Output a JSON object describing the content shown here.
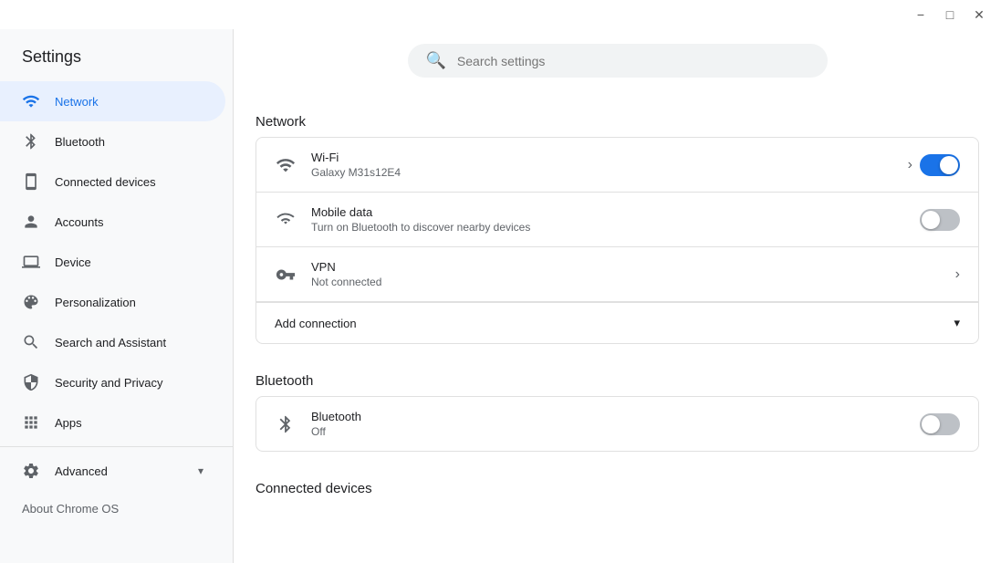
{
  "window": {
    "title": "Settings"
  },
  "titlebar": {
    "minimize_label": "−",
    "maximize_label": "□",
    "close_label": "✕"
  },
  "sidebar": {
    "title": "Settings",
    "items": [
      {
        "id": "network",
        "label": "Network",
        "icon": "network"
      },
      {
        "id": "bluetooth",
        "label": "Bluetooth",
        "icon": "bluetooth"
      },
      {
        "id": "connected-devices",
        "label": "Connected devices",
        "icon": "connected-devices"
      },
      {
        "id": "accounts",
        "label": "Accounts",
        "icon": "accounts"
      },
      {
        "id": "device",
        "label": "Device",
        "icon": "device"
      },
      {
        "id": "personalization",
        "label": "Personalization",
        "icon": "personalization"
      },
      {
        "id": "search-and-assistant",
        "label": "Search and Assistant",
        "icon": "search-assistant"
      },
      {
        "id": "security-and-privacy",
        "label": "Security and Privacy",
        "icon": "security"
      },
      {
        "id": "apps",
        "label": "Apps",
        "icon": "apps"
      },
      {
        "id": "advanced",
        "label": "Advanced",
        "icon": "advanced"
      }
    ],
    "about_label": "About Chrome OS"
  },
  "search": {
    "placeholder": "Search settings"
  },
  "main": {
    "network_section": {
      "heading": "Network",
      "wifi": {
        "title": "Wi-Fi",
        "subtitle": "Galaxy M31s12E4",
        "enabled": true
      },
      "mobile_data": {
        "title": "Mobile data",
        "subtitle": "Turn on Bluetooth to discover nearby devices",
        "enabled": false
      },
      "vpn": {
        "title": "VPN",
        "subtitle": "Not connected"
      },
      "add_connection": "Add connection"
    },
    "bluetooth_section": {
      "heading": "Bluetooth",
      "bluetooth": {
        "title": "Bluetooth",
        "subtitle": "Off",
        "enabled": false
      }
    },
    "connected_devices_section": {
      "heading": "Connected devices"
    }
  }
}
